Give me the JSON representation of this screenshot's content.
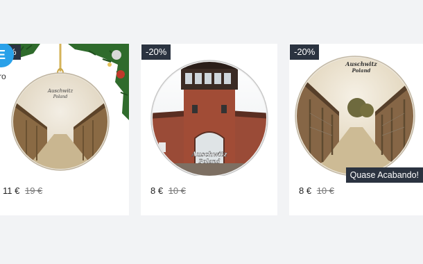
{
  "products": [
    {
      "badge": "%",
      "store_logo": "E",
      "side_label": "ro",
      "ornament_text": [
        "Auschwitz",
        "Poland"
      ],
      "price": "11 €",
      "old_price": "19 €"
    },
    {
      "badge": "-20%",
      "ornament_text": [
        "Auschwitz",
        "Poland"
      ],
      "price": "8 €",
      "old_price": "10 €"
    },
    {
      "badge": "-20%",
      "ornament_text": [
        "Auschwitz",
        "Poland"
      ],
      "price": "8 €",
      "old_price": "10 €",
      "tag": "Quase Acabando!"
    }
  ],
  "colors": {
    "page_bg": "#f2f3f5",
    "card_bg": "#ffffff",
    "badge_bg": "#2b3340",
    "logo_blue": "#2aa1e9"
  }
}
